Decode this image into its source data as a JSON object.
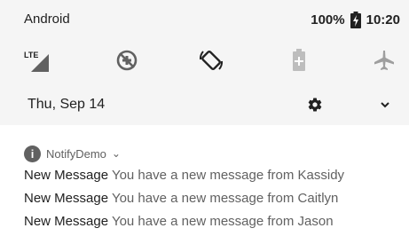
{
  "status_bar": {
    "carrier": "Android",
    "battery": "100%",
    "time": "10:20"
  },
  "quick_settings": [
    {
      "name": "lte-signal-icon",
      "label": "LTE"
    },
    {
      "name": "data-saver-icon"
    },
    {
      "name": "auto-rotate-icon"
    },
    {
      "name": "battery-saver-icon"
    },
    {
      "name": "airplane-mode-icon"
    }
  ],
  "shade_footer": {
    "date": "Thu, Sep 14",
    "settings_icon": "gear-icon",
    "expand_icon": "chevron-down-icon"
  },
  "notification": {
    "app_icon": "info-icon",
    "app_icon_glyph": "i",
    "app_name": "NotifyDemo",
    "chevron": "⌄",
    "messages": [
      {
        "title": "New Message",
        "text": "You have a new message from Kassidy"
      },
      {
        "title": "New Message",
        "text": "You have a new message from Caitlyn"
      },
      {
        "title": "New Message",
        "text": "You have a new message from Jason"
      }
    ]
  },
  "colors": {
    "shade_background": "#f5f5f5",
    "icon_color": "#616161",
    "text_primary": "#212121",
    "text_secondary": "#616161"
  }
}
